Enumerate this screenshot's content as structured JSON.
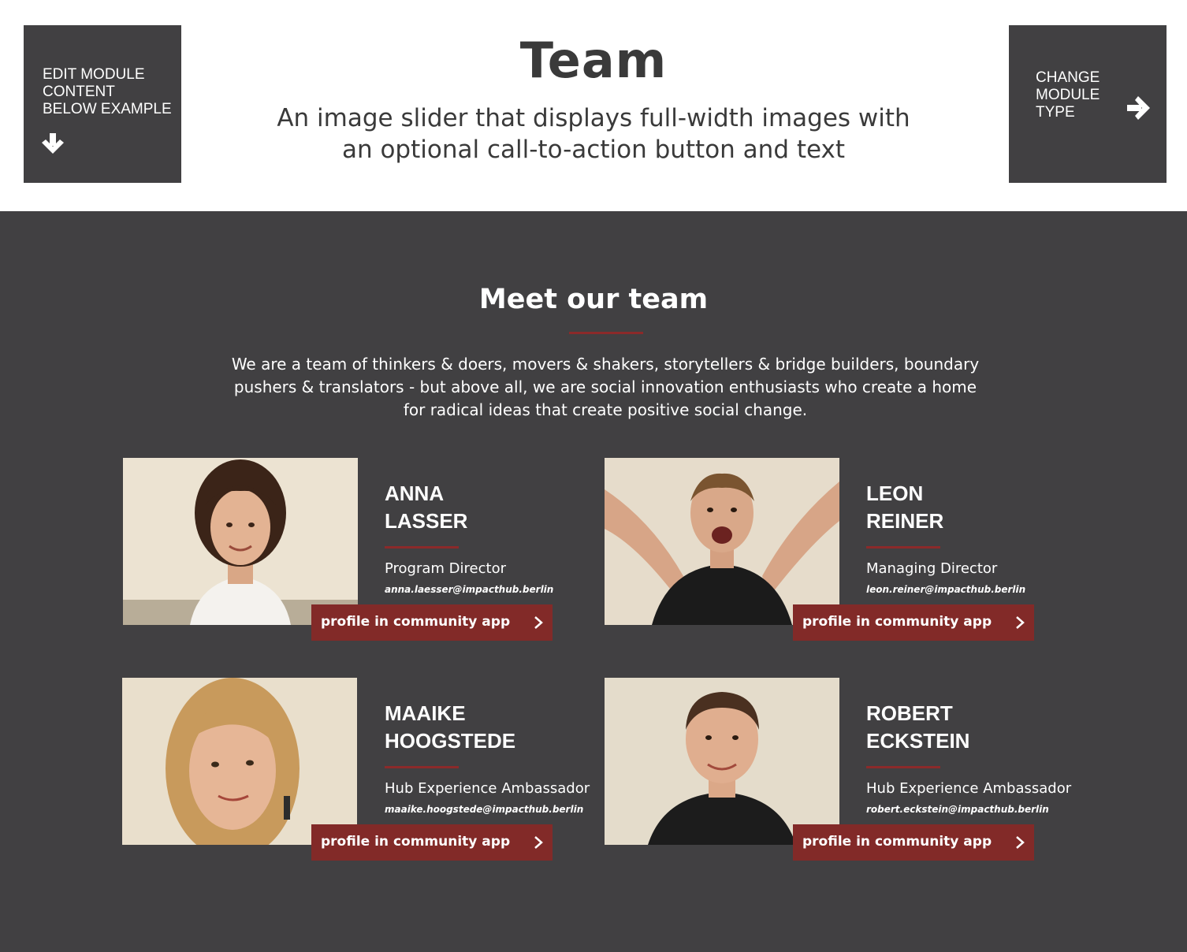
{
  "header": {
    "edit_button": {
      "label": "EDIT MODULE\nCONTENT\nBELOW EXAMPLE",
      "icon": "arrow-down-icon"
    },
    "change_button": {
      "label": "CHANGE\nMODULE\nTYPE",
      "icon": "arrow-right-icon"
    },
    "title": "Team",
    "description": "An image slider that displays full-width images with an optional call-to-action button and text"
  },
  "team": {
    "heading": "Meet our team",
    "intro": "We are a team of thinkers & doers, movers & shakers, storytellers & bridge builders, boundary pushers & translators - but above all, we are social innovation enthusiasts who create a home for radical ideas that create positive social change.",
    "members": [
      {
        "name": "ANNA\nLASSER",
        "role": "Program Director",
        "email": "anna.laesser@impacthub.berlin",
        "cta": "profile in community app",
        "photo": "portrait-woman-curly-hair"
      },
      {
        "name": "LEON\nREINER",
        "role": "Managing Director",
        "email": "leon.reiner@impacthub.berlin",
        "cta": "profile in community app",
        "photo": "portrait-man-arms-raised"
      },
      {
        "name": "MAAIKE\nHOOGSTEDE",
        "role": "Hub Experience Ambassador",
        "email": "maaike.hoogstede@impacthub.berlin",
        "cta": "profile in community app",
        "photo": "portrait-woman-blonde"
      },
      {
        "name": "ROBERT\nECKSTEIN",
        "role": "Hub Experience Ambassador",
        "email": "robert.eckstein@impacthub.berlin",
        "cta": "profile in community app",
        "photo": "portrait-man-dark-polo"
      }
    ]
  },
  "colors": {
    "dark": "#414042",
    "accent": "#822a28",
    "rule": "#8b2a2a",
    "text_dark": "#3a3a3a"
  }
}
